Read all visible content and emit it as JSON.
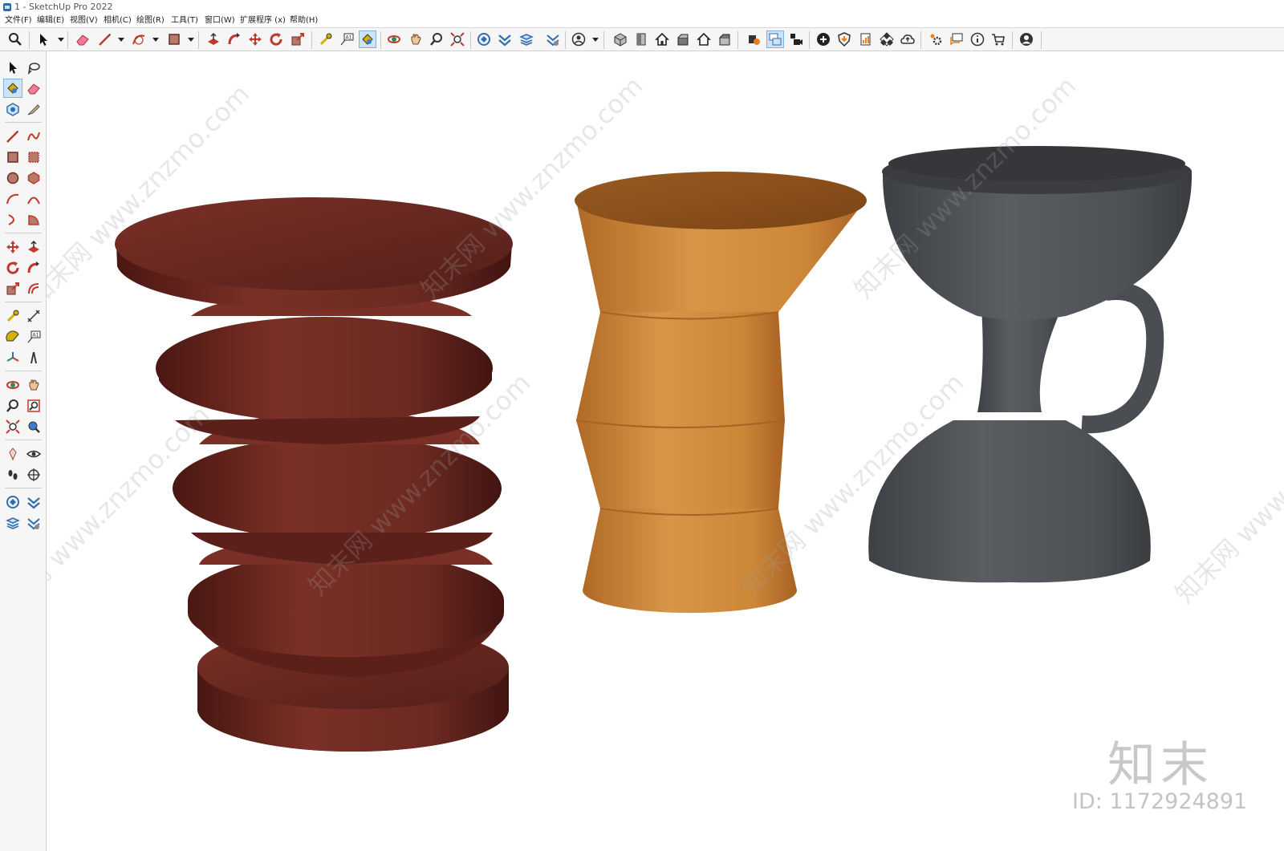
{
  "window": {
    "title": "1 - SketchUp Pro 2022"
  },
  "menu": {
    "items": [
      "文件(F)",
      "编辑(E)",
      "视图(V)",
      "相机(C)",
      "绘图(R)",
      "工具(T)",
      "窗口(W)",
      "扩展程序 (x)",
      "帮助(H)"
    ]
  },
  "toolbar": {
    "active_tool": "paint-bucket",
    "buttons": [
      "search-icon",
      "select-arrow-icon",
      "eraser-icon",
      "pencil-line-icon",
      "arc-icon",
      "rectangle-icon",
      "push-pull-icon",
      "follow-me-icon",
      "move-icon",
      "rotate-icon",
      "scale-icon",
      "tape-measure-icon",
      "text-icon",
      "paint-bucket-icon",
      "orbit-icon",
      "pan-icon",
      "zoom-icon",
      "zoom-extents-icon",
      "warehouse-icon",
      "extension-icon",
      "layers-icon",
      "sandbox-icon",
      "user-icon",
      "iso-view-icon",
      "top-view-icon",
      "front-view-icon",
      "right-view-icon",
      "back-view-icon",
      "left-view-icon",
      "section-icon",
      "layout-icon",
      "camera-icon",
      "add-icon",
      "shield-icon",
      "report-icon",
      "checker-icon",
      "cloud-icon",
      "settings-icon",
      "chat-icon",
      "info-icon",
      "cart-icon",
      "account-icon"
    ]
  },
  "viewport": {
    "watermark_text": "知末网 www.znzmo.com",
    "brand": "知末",
    "image_id": "ID: 1172924891",
    "colors": {
      "red_stool": "#6b2a22",
      "orange_stool": "#d08a3c",
      "gray_stool": "#4d5054"
    }
  }
}
